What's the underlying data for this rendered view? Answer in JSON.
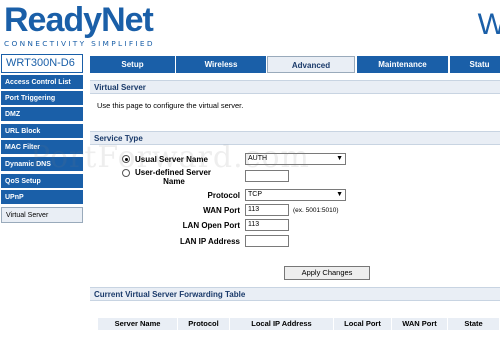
{
  "brand": {
    "name_part1": "Ready",
    "name_part2": "Net",
    "tagline": "CONNECTIVITY SIMPLIFIED",
    "header_right": "W"
  },
  "model": "WRT300N-D6",
  "tabs": [
    {
      "label": "Setup"
    },
    {
      "label": "Wireless"
    },
    {
      "label": "Advanced"
    },
    {
      "label": "Maintenance"
    },
    {
      "label": "Statu"
    }
  ],
  "sidebar": [
    {
      "label": "Access Control List"
    },
    {
      "label": "Port Triggering"
    },
    {
      "label": "DMZ"
    },
    {
      "label": "URL Block"
    },
    {
      "label": "MAC Filter"
    },
    {
      "label": "Dynamic DNS"
    },
    {
      "label": "QoS Setup"
    },
    {
      "label": "UPnP"
    },
    {
      "label": "Virtual Server"
    }
  ],
  "virtual_server": {
    "title": "Virtual Server",
    "description": "Use this page to configure the virtual server."
  },
  "service_type": {
    "title": "Service Type",
    "usual_label": "Usual Server Name",
    "usual_value": "AUTH",
    "user_defined_label_line1": "User-defined Server",
    "user_defined_label_line2": "Name",
    "user_defined_value": "",
    "protocol_label": "Protocol",
    "protocol_value": "TCP",
    "wan_port_label": "WAN Port",
    "wan_port_value": "113",
    "wan_port_hint": "(ex. 5001:5010)",
    "lan_open_port_label": "LAN Open Port",
    "lan_open_port_value": "113",
    "lan_ip_label": "LAN IP Address",
    "lan_ip_value": ""
  },
  "apply_label": "Apply Changes",
  "forwarding_table": {
    "title": "Current Virtual Server Forwarding Table",
    "columns": [
      "Server Name",
      "Protocol",
      "Local IP Address",
      "Local Port",
      "WAN Port",
      "State"
    ]
  },
  "watermark": "PortForward.com"
}
